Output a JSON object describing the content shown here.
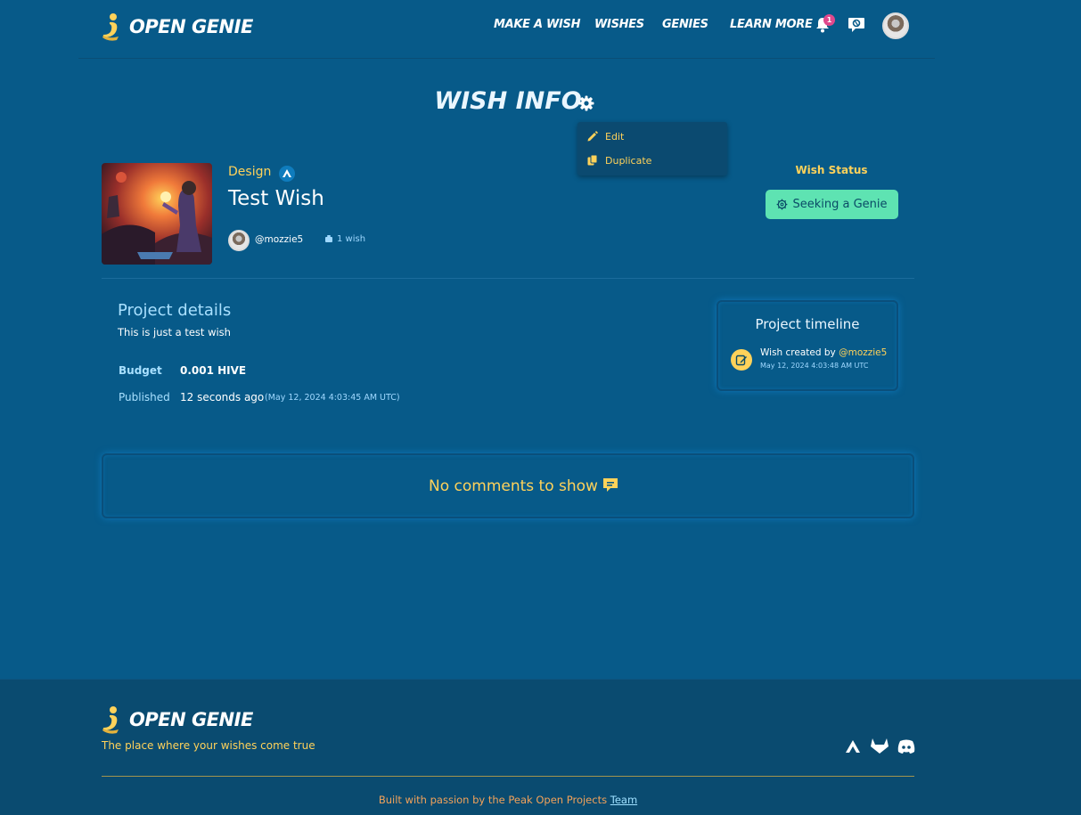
{
  "brand": {
    "name": "OPEN GENIE"
  },
  "nav": {
    "items": [
      "MAKE A WISH",
      "WISHES",
      "GENIES",
      "LEARN MORE"
    ],
    "notifications_count": "1"
  },
  "page": {
    "title": "WISH INFO"
  },
  "menu": {
    "edit": "Edit",
    "duplicate": "Duplicate"
  },
  "wish": {
    "category": "Design",
    "title": "Test Wish",
    "owner": "@mozzie5",
    "wish_count": "1 wish",
    "status_label": "Wish Status",
    "status": "Seeking a Genie"
  },
  "details": {
    "heading": "Project details",
    "description": "This is just a test wish",
    "budget_label": "Budget",
    "budget_value": "0.001 HIVE",
    "published_label": "Published",
    "published_value": "12 seconds ago",
    "published_date": "(May 12, 2024 4:03:45 AM UTC)"
  },
  "timeline": {
    "heading": "Project timeline",
    "event_text": "Wish created by",
    "event_user": "@mozzie5",
    "event_date": "May 12, 2024 4:03:48 AM UTC"
  },
  "comments": {
    "empty_text": "No comments to show"
  },
  "footer": {
    "brand": "OPEN GENIE",
    "tagline": "The place where your wishes come true",
    "credits": "Built with passion by the Peak Open Projects",
    "credits_link": "Team",
    "social": [
      "hive-icon",
      "gitlab-icon",
      "discord-icon"
    ]
  },
  "colors": {
    "background": "#075a89",
    "accent": "#ffd25a",
    "status": "#5ee3b2",
    "footer": "#0a4b70"
  }
}
